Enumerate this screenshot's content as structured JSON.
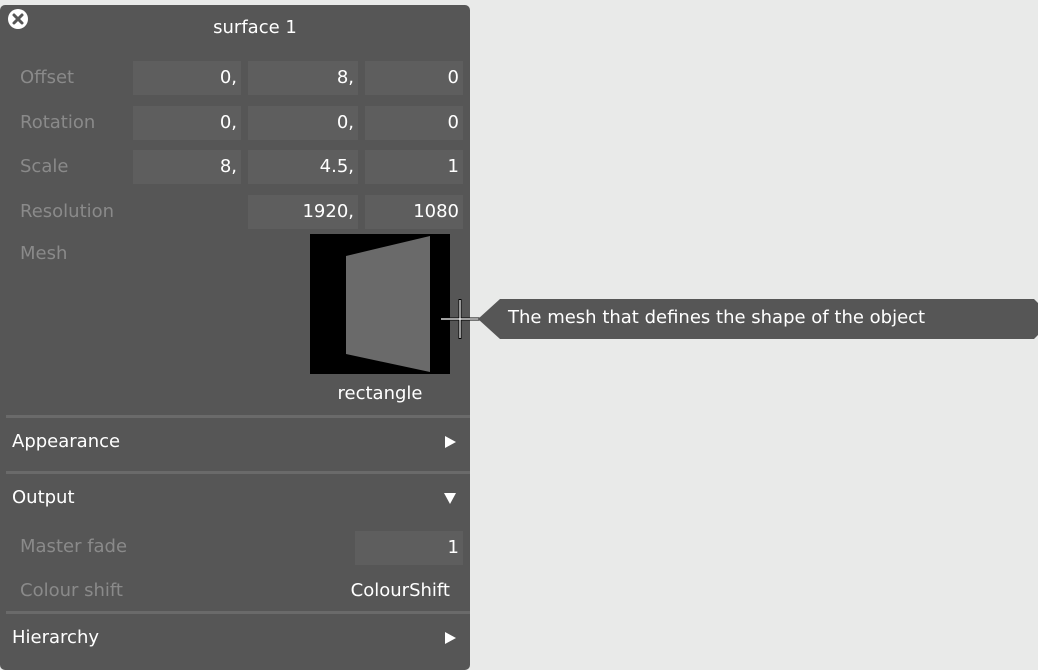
{
  "panel": {
    "title": "surface 1",
    "rows": [
      {
        "label": "Offset",
        "values": [
          "0,",
          "8,",
          "0"
        ]
      },
      {
        "label": "Rotation",
        "values": [
          "0,",
          "0,",
          "0"
        ]
      },
      {
        "label": "Scale",
        "values": [
          "8,",
          "4.5,",
          "1"
        ]
      },
      {
        "label": "Resolution",
        "values": [
          "1920,",
          "1080"
        ]
      }
    ],
    "mesh": {
      "label": "Mesh",
      "name": "rectangle"
    },
    "sections": {
      "appearance": "Appearance",
      "output": "Output",
      "hierarchy": "Hierarchy"
    },
    "output": {
      "master_fade_label": "Master fade",
      "master_fade_value": "1",
      "colour_shift_label": "Colour shift",
      "colour_shift_value": "ColourShift"
    }
  },
  "tooltip": {
    "text": "The mesh that defines the shape of the object"
  },
  "icons": {
    "close": "close-icon",
    "collapsed": "triangle-right-icon",
    "expanded": "triangle-down-icon",
    "cursor": "crosshair-icon"
  },
  "colors": {
    "panel_bg": "#565656",
    "field_bg": "#5e5e5e",
    "label_text": "#8a8a8a",
    "tooltip_bg": "#565656",
    "page_bg": "#e9eae9"
  }
}
